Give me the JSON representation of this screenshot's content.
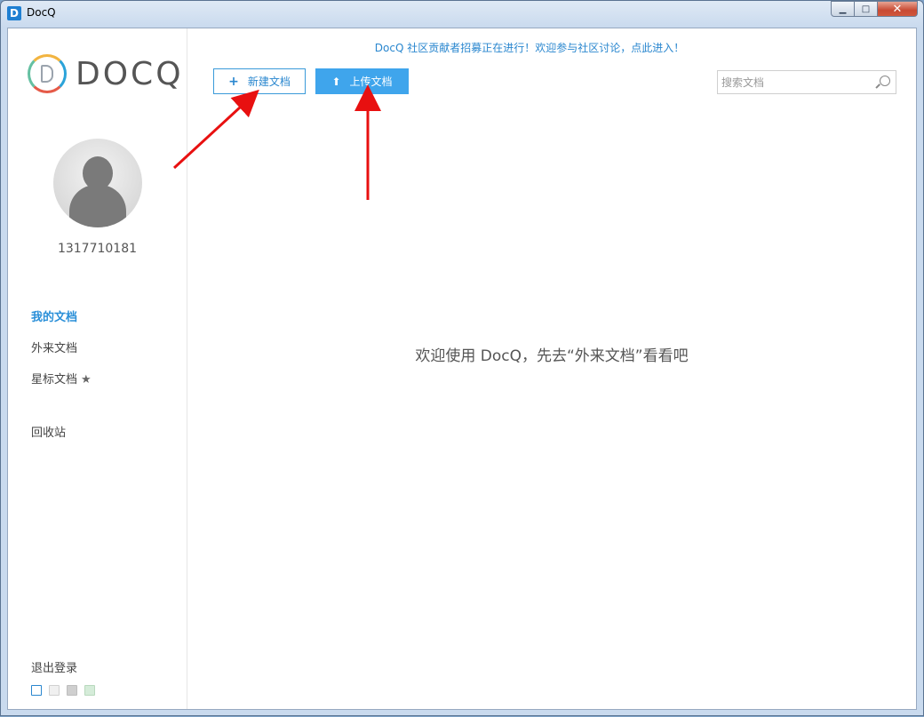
{
  "window": {
    "title": "DocQ",
    "app_icon_letter": "D"
  },
  "controls": {
    "min": "▁",
    "max": "□",
    "close": "✕"
  },
  "sidebar": {
    "logo_text": "DOCQ",
    "username": "1317710181",
    "nav": [
      {
        "label": "我的文档",
        "active": true
      },
      {
        "label": "外来文档",
        "active": false
      },
      {
        "label": "星标文档",
        "active": false
      },
      {
        "label": "回收站",
        "active": false
      }
    ],
    "star_icon": "★",
    "logout_label": "退出登录",
    "theme_colors": [
      "#ffffff",
      "#f0f0f0",
      "#cfcfcf",
      "#d5ecd9"
    ]
  },
  "main": {
    "notice": "DocQ 社区贡献者招募正在进行！欢迎参与社区讨论，点此进入！",
    "new_doc_label": "新建文档",
    "new_doc_icon": "+",
    "upload_label": "上传文档",
    "upload_icon": "⬆",
    "search_placeholder": "搜索文档",
    "empty_message": "欢迎使用 DocQ，先去“外来文档”看看吧"
  },
  "colors": {
    "accent": "#2a87cf",
    "arrow": "#e81010"
  }
}
